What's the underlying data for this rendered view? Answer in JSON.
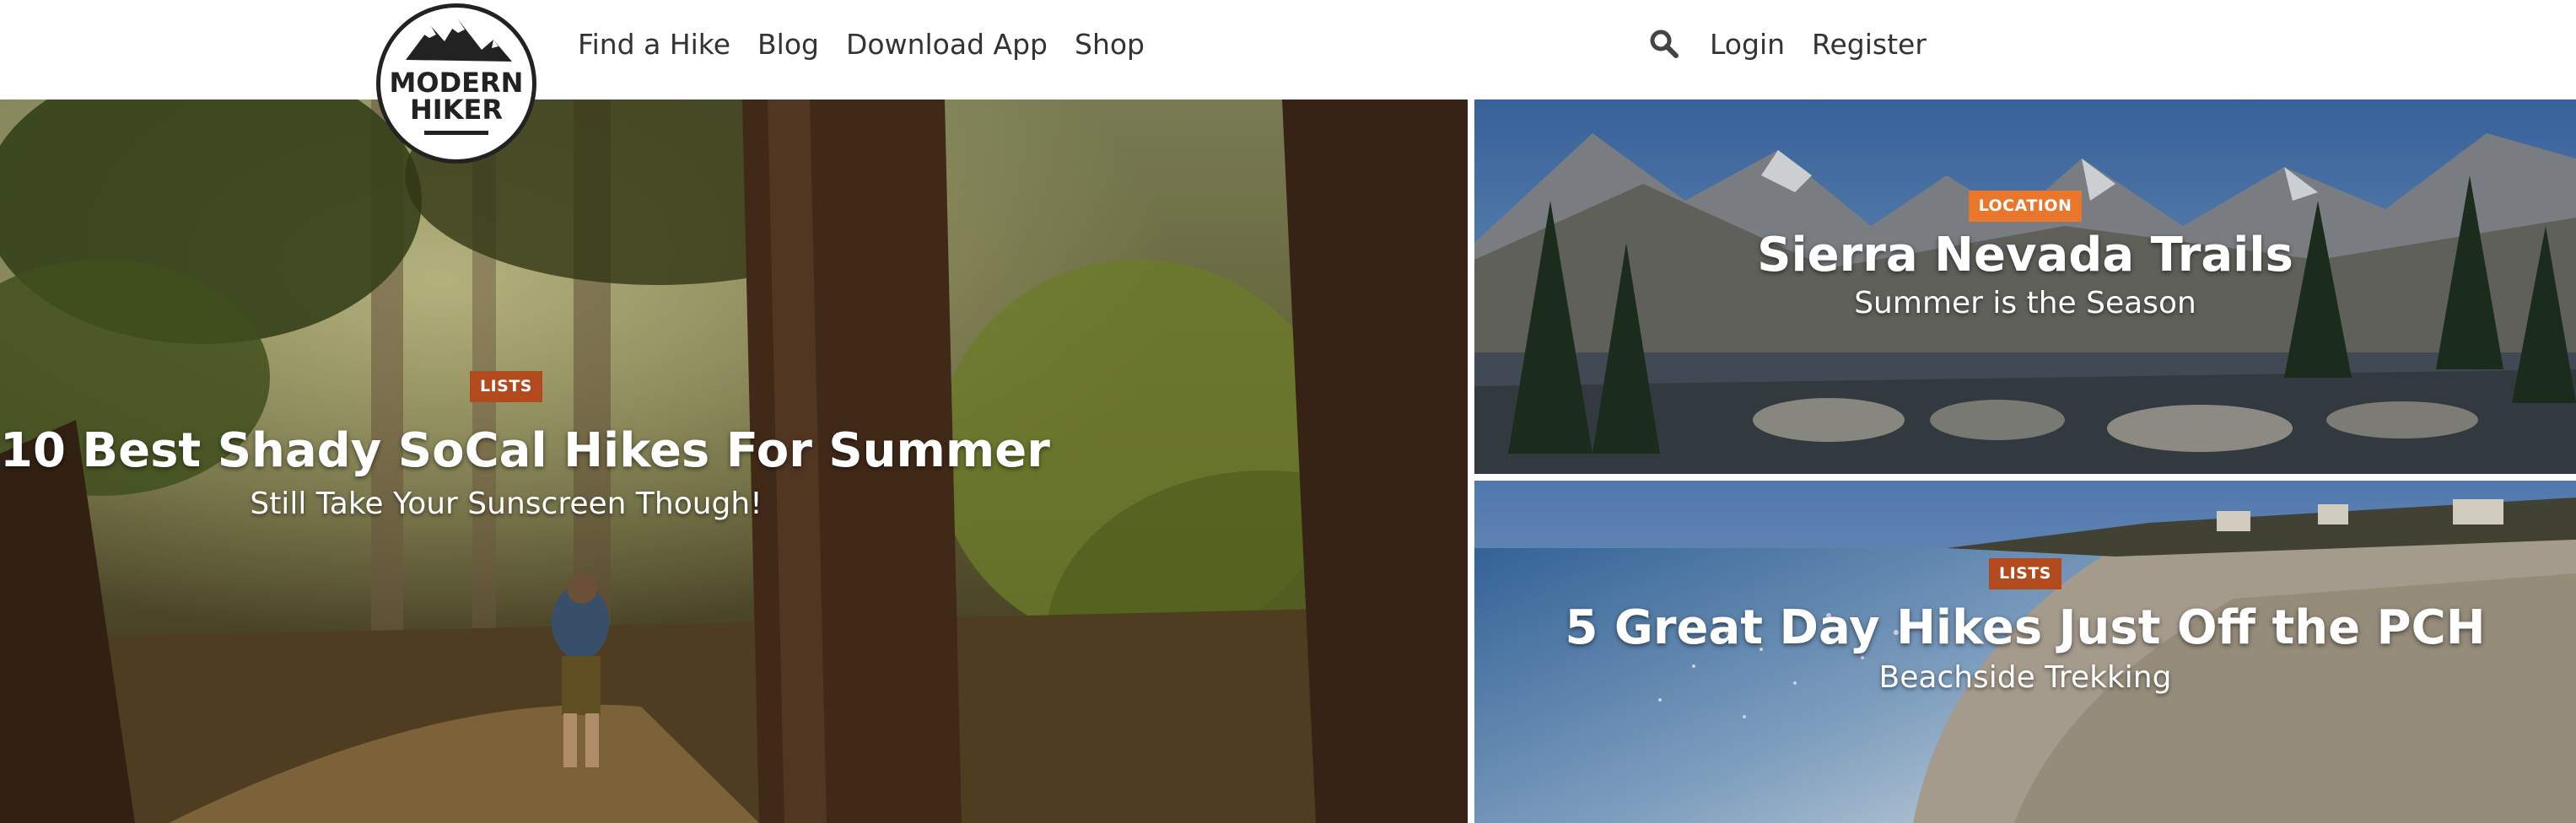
{
  "brand": {
    "logo_line1": "MODERN",
    "logo_line2": "HIKER"
  },
  "nav": {
    "items": [
      {
        "label": "Find a Hike"
      },
      {
        "label": "Blog"
      },
      {
        "label": "Download App"
      },
      {
        "label": "Shop"
      }
    ]
  },
  "auth": {
    "search_icon": "search-icon",
    "login": "Login",
    "register": "Register"
  },
  "colors": {
    "badge_lists": "#b24a1e",
    "badge_location": "#e8762b"
  },
  "features": {
    "main": {
      "badge": "LISTS",
      "title": "10 Best Shady SoCal Hikes For Summer",
      "subtitle": "Still Take Your Sunscreen Though!"
    },
    "top": {
      "badge": "LOCATION",
      "title": "Sierra Nevada Trails",
      "subtitle": "Summer is the Season"
    },
    "bottom": {
      "badge": "LISTS",
      "title": "5 Great Day Hikes Just Off the PCH",
      "subtitle": "Beachside Trekking"
    }
  }
}
